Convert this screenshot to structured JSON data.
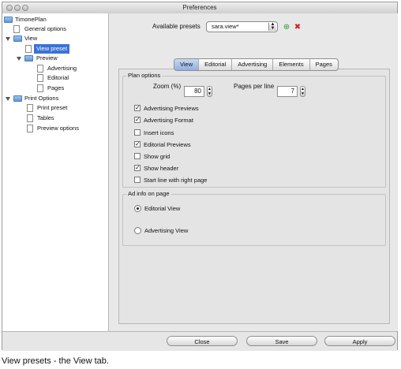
{
  "window": {
    "title": "Preferences"
  },
  "sidebar": {
    "items": [
      {
        "label": "TimonePlan",
        "level": 0
      },
      {
        "label": "General options",
        "level": 1
      },
      {
        "label": "View",
        "level": 0
      },
      {
        "label": "View preset",
        "level": 1,
        "selected": true
      },
      {
        "label": "Preview",
        "level": 1
      },
      {
        "label": "Advertising",
        "level": 2
      },
      {
        "label": "Editorial",
        "level": 2
      },
      {
        "label": "Pages",
        "level": 2
      },
      {
        "label": "Print Options",
        "level": 0
      },
      {
        "label": "Print preset",
        "level": 1
      },
      {
        "label": "Tables",
        "level": 1
      },
      {
        "label": "Preview options",
        "level": 1
      }
    ]
  },
  "presets": {
    "label": "Available presets",
    "selected": "sara.view*"
  },
  "tabs": [
    "View",
    "Editorial",
    "Advertising",
    "Elements",
    "Pages"
  ],
  "plan_options": {
    "title": "Plan options",
    "zoom_label": "Zoom (%)",
    "zoom_value": "80",
    "pages_per_line_label": "Pages per line",
    "pages_per_line_value": "7",
    "checks": [
      {
        "label": "Advertising Previews",
        "checked": true
      },
      {
        "label": "Advertising Format",
        "checked": true
      },
      {
        "label": "Insert icons",
        "checked": false
      },
      {
        "label": "Editorial Previews",
        "checked": true
      },
      {
        "label": "Show grid",
        "checked": false
      },
      {
        "label": "Show header",
        "checked": true
      },
      {
        "label": "Start line with right page",
        "checked": false
      }
    ]
  },
  "ad_info": {
    "title": "Ad info on page",
    "options": [
      {
        "label": "Editorial View",
        "selected": true
      },
      {
        "label": "Advertising View",
        "selected": false
      }
    ]
  },
  "buttons": {
    "close": "Close",
    "save": "Save",
    "apply": "Apply"
  },
  "caption": "View presets - the View tab."
}
